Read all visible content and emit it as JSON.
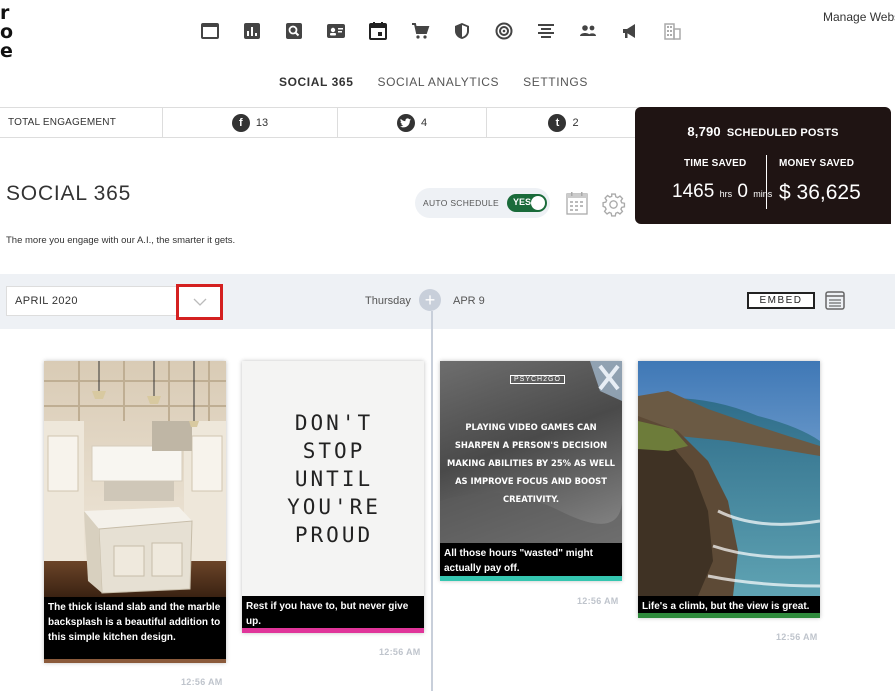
{
  "logo": {
    "l1": "r",
    "l2": "o",
    "l3": "e"
  },
  "header": {
    "manage_link": "Manage Webs"
  },
  "top_icons": [
    "window-icon",
    "chart-icon",
    "search-icon",
    "profile-card-icon",
    "calendar-icon",
    "cart-icon",
    "shield-icon",
    "target-icon",
    "align-icon",
    "users-icon",
    "megaphone-icon",
    "building-icon"
  ],
  "nav": {
    "tabs": [
      {
        "label": "SOCIAL 365",
        "active": true
      },
      {
        "label": "SOCIAL ANALYTICS",
        "active": false
      },
      {
        "label": "SETTINGS",
        "active": false
      }
    ]
  },
  "engagement": {
    "label": "TOTAL ENGAGEMENT",
    "facebook": {
      "glyph": "f",
      "count": "13"
    },
    "twitter": {
      "glyph": "t",
      "count": "4"
    },
    "tumblr": {
      "glyph": "t",
      "count": "2"
    }
  },
  "scheduled": {
    "count": "8,790",
    "label": "SCHEDULED POSTS",
    "time_saved_label": "TIME SAVED",
    "money_saved_label": "MONEY SAVED",
    "hours": "1465",
    "hours_unit": "hrs",
    "mins": "0",
    "mins_unit": "mins",
    "money": "$ 36,625"
  },
  "page": {
    "title": "SOCIAL 365",
    "subtitle": "The more you engage with our A.I., the smarter it gets.",
    "auto_schedule_label": "AUTO SCHEDULE",
    "auto_schedule_value": "YES"
  },
  "datebar": {
    "month": "APRIL 2020",
    "day_name": "Thursday",
    "day_date": "APR 9",
    "plus": "+",
    "embed_label": "EMBED"
  },
  "cards": [
    {
      "caption": "The thick island slab and the marble backsplash is a beautiful addition to this simple kitchen design.",
      "time": "12:56 AM",
      "bar_color": "#8a5a3b"
    },
    {
      "quote": [
        "DON'T",
        "STOP",
        "UNTIL",
        "YOU'RE",
        "PROUD"
      ],
      "caption": "Rest if you have to, but never give up.",
      "time": "12:56 AM",
      "bar_color": "#e0359a"
    },
    {
      "brand": "PSYCH2GO",
      "headline": "PLAYING VIDEO GAMES CAN SHARPEN A PERSON'S DECISION MAKING ABILITIES BY 25% AS WELL AS IMPROVE FOCUS AND BOOST CREATIVITY.",
      "caption": "All those hours \"wasted\" might actually pay off.",
      "time": "12:56 AM",
      "bar_color": "#35c6b0"
    },
    {
      "caption": "Life's a climb, but the view is great.",
      "time": "12:56 AM",
      "bar_color": "#2f8a3c"
    }
  ]
}
